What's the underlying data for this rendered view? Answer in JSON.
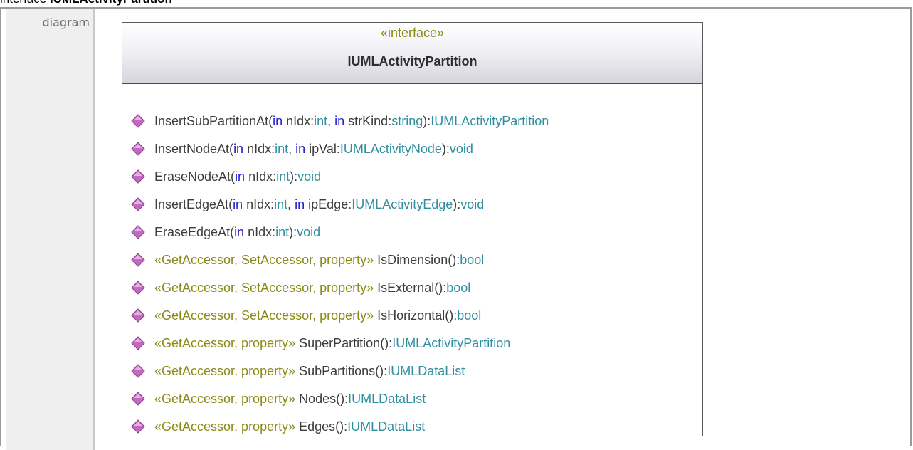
{
  "heading": {
    "prefix": "interface",
    "name": "IUMLActivityPartition"
  },
  "section_label": "diagram",
  "uml_class": {
    "stereotype": "«interface»",
    "name": "IUMLActivityPartition",
    "operations": [
      {
        "stereo": "",
        "sig": [
          [
            "nm",
            "InsertSubPartitionAt("
          ],
          [
            "kw",
            "in"
          ],
          [
            "nm",
            " nIdx:"
          ],
          [
            "ty",
            "int"
          ],
          [
            "nm",
            ", "
          ],
          [
            "kw",
            "in"
          ],
          [
            "nm",
            " strKind:"
          ],
          [
            "ty",
            "string"
          ],
          [
            "nm",
            "):"
          ],
          [
            "ty",
            "IUMLActivityPartition"
          ]
        ]
      },
      {
        "stereo": "",
        "sig": [
          [
            "nm",
            "InsertNodeAt("
          ],
          [
            "kw",
            "in"
          ],
          [
            "nm",
            " nIdx:"
          ],
          [
            "ty",
            "int"
          ],
          [
            "nm",
            ", "
          ],
          [
            "kw",
            "in"
          ],
          [
            "nm",
            " ipVal:"
          ],
          [
            "ty",
            "IUMLActivityNode"
          ],
          [
            "nm",
            "):"
          ],
          [
            "ty",
            "void"
          ]
        ]
      },
      {
        "stereo": "",
        "sig": [
          [
            "nm",
            "EraseNodeAt("
          ],
          [
            "kw",
            "in"
          ],
          [
            "nm",
            " nIdx:"
          ],
          [
            "ty",
            "int"
          ],
          [
            "nm",
            "):"
          ],
          [
            "ty",
            "void"
          ]
        ]
      },
      {
        "stereo": "",
        "sig": [
          [
            "nm",
            "InsertEdgeAt("
          ],
          [
            "kw",
            "in"
          ],
          [
            "nm",
            " nIdx:"
          ],
          [
            "ty",
            "int"
          ],
          [
            "nm",
            ", "
          ],
          [
            "kw",
            "in"
          ],
          [
            "nm",
            " ipEdge:"
          ],
          [
            "ty",
            "IUMLActivityEdge"
          ],
          [
            "nm",
            "):"
          ],
          [
            "ty",
            "void"
          ]
        ]
      },
      {
        "stereo": "",
        "sig": [
          [
            "nm",
            "EraseEdgeAt("
          ],
          [
            "kw",
            "in"
          ],
          [
            "nm",
            " nIdx:"
          ],
          [
            "ty",
            "int"
          ],
          [
            "nm",
            "):"
          ],
          [
            "ty",
            "void"
          ]
        ]
      },
      {
        "stereo": "«GetAccessor, SetAccessor, property»",
        "sig": [
          [
            "nm",
            "IsDimension():"
          ],
          [
            "ty",
            "bool"
          ]
        ]
      },
      {
        "stereo": "«GetAccessor, SetAccessor, property»",
        "sig": [
          [
            "nm",
            "IsExternal():"
          ],
          [
            "ty",
            "bool"
          ]
        ]
      },
      {
        "stereo": "«GetAccessor, SetAccessor, property»",
        "sig": [
          [
            "nm",
            "IsHorizontal():"
          ],
          [
            "ty",
            "bool"
          ]
        ]
      },
      {
        "stereo": "«GetAccessor, property»",
        "sig": [
          [
            "nm",
            "SuperPartition():"
          ],
          [
            "ty",
            "IUMLActivityPartition"
          ]
        ]
      },
      {
        "stereo": "«GetAccessor, property»",
        "sig": [
          [
            "nm",
            "SubPartitions():"
          ],
          [
            "ty",
            "IUMLDataList"
          ]
        ]
      },
      {
        "stereo": "«GetAccessor, property»",
        "sig": [
          [
            "nm",
            "Nodes():"
          ],
          [
            "ty",
            "IUMLDataList"
          ]
        ]
      },
      {
        "stereo": "«GetAccessor, property»",
        "sig": [
          [
            "nm",
            "Edges():"
          ],
          [
            "ty",
            "IUMLDataList"
          ]
        ]
      }
    ]
  },
  "colors": {
    "keyword": "#1d1dc9",
    "type": "#2f8e9f",
    "stereotype": "#8a8a18",
    "operation_icon": "#c26ac0"
  }
}
